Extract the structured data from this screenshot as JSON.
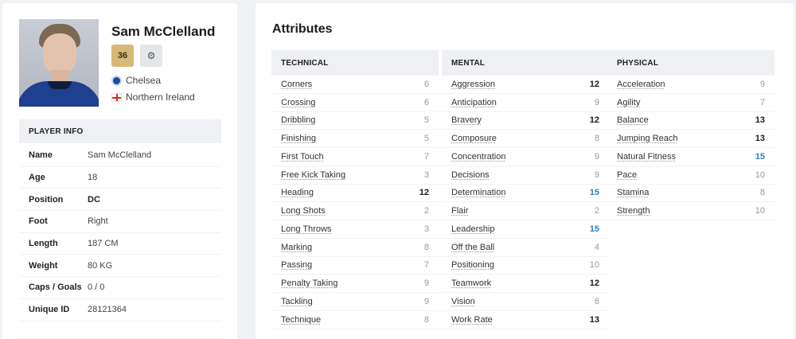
{
  "player": {
    "name": "Sam McClelland",
    "ca_badge": "36",
    "badge_icon": "settings-icon",
    "club": "Chelsea",
    "nation": "Northern Ireland"
  },
  "player_info": {
    "header": "PLAYER INFO",
    "rows": [
      {
        "label": "Name",
        "value": "Sam McClelland"
      },
      {
        "label": "Age",
        "value": "18"
      },
      {
        "label": "Position",
        "value": "DC"
      },
      {
        "label": "Foot",
        "value": "Right"
      },
      {
        "label": "Length",
        "value": "187 CM"
      },
      {
        "label": "Weight",
        "value": "80 KG"
      },
      {
        "label": "Caps / Goals",
        "value": "0 / 0"
      },
      {
        "label": "Unique ID",
        "value": "28121364"
      }
    ]
  },
  "attributes": {
    "title": "Attributes",
    "technical": {
      "header": "TECHNICAL",
      "rows": [
        {
          "name": "Corners",
          "value": "6"
        },
        {
          "name": "Crossing",
          "value": "6"
        },
        {
          "name": "Dribbling",
          "value": "5"
        },
        {
          "name": "Finishing",
          "value": "5"
        },
        {
          "name": "First Touch",
          "value": "7"
        },
        {
          "name": "Free Kick Taking",
          "value": "3"
        },
        {
          "name": "Heading",
          "value": "12"
        },
        {
          "name": "Long Shots",
          "value": "2"
        },
        {
          "name": "Long Throws",
          "value": "3"
        },
        {
          "name": "Marking",
          "value": "8"
        },
        {
          "name": "Passing",
          "value": "7"
        },
        {
          "name": "Penalty Taking",
          "value": "9"
        },
        {
          "name": "Tackling",
          "value": "9"
        },
        {
          "name": "Technique",
          "value": "8"
        }
      ]
    },
    "mental": {
      "header": "MENTAL",
      "rows": [
        {
          "name": "Aggression",
          "value": "12"
        },
        {
          "name": "Anticipation",
          "value": "9"
        },
        {
          "name": "Bravery",
          "value": "12"
        },
        {
          "name": "Composure",
          "value": "8"
        },
        {
          "name": "Concentration",
          "value": "9"
        },
        {
          "name": "Decisions",
          "value": "9"
        },
        {
          "name": "Determination",
          "value": "15"
        },
        {
          "name": "Flair",
          "value": "2"
        },
        {
          "name": "Leadership",
          "value": "15"
        },
        {
          "name": "Off the Ball",
          "value": "4"
        },
        {
          "name": "Positioning",
          "value": "10"
        },
        {
          "name": "Teamwork",
          "value": "12"
        },
        {
          "name": "Vision",
          "value": "6"
        },
        {
          "name": "Work Rate",
          "value": "13"
        }
      ]
    },
    "physical": {
      "header": "PHYSICAL",
      "rows": [
        {
          "name": "Acceleration",
          "value": "9"
        },
        {
          "name": "Agility",
          "value": "7"
        },
        {
          "name": "Balance",
          "value": "13"
        },
        {
          "name": "Jumping Reach",
          "value": "13"
        },
        {
          "name": "Natural Fitness",
          "value": "15"
        },
        {
          "name": "Pace",
          "value": "10"
        },
        {
          "name": "Stamina",
          "value": "8"
        },
        {
          "name": "Strength",
          "value": "10"
        }
      ]
    }
  }
}
